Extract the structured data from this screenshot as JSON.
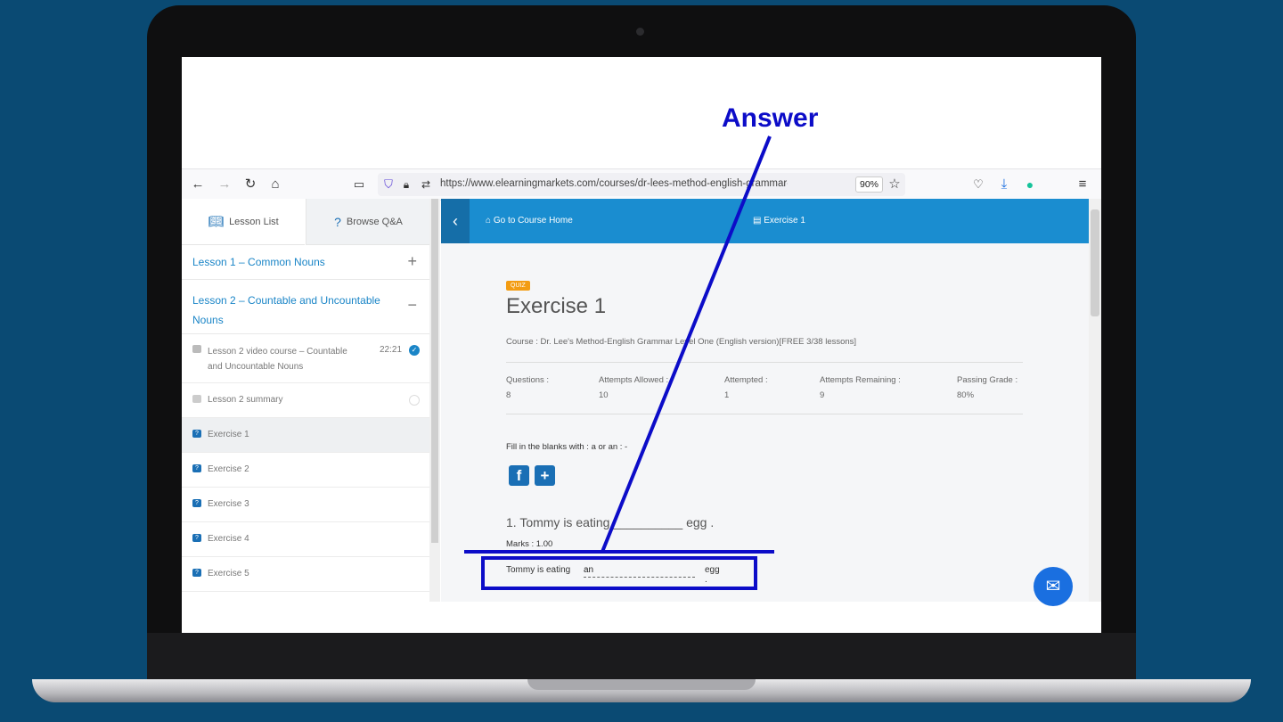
{
  "browser": {
    "url": "https://www.elearningmarkets.com/courses/dr-lees-method-english-grammar-level-one-engl",
    "zoom": "90%"
  },
  "sidebar": {
    "tabs": [
      "Lesson List",
      "Browse Q&A"
    ],
    "lesson1": "Lesson 1 – Common Nouns",
    "lesson2": "Lesson 2 – Countable and Uncountable Nouns",
    "video_line1": "Lesson 2 video course – Countable",
    "video_line2": "and Uncountable Nouns",
    "video_duration": "22:21",
    "summary": "Lesson 2 summary",
    "exercises": [
      "Exercise 1",
      "Exercise 2",
      "Exercise 3",
      "Exercise 4",
      "Exercise 5"
    ]
  },
  "main": {
    "go_home": "Go to Course Home",
    "crumb": "Exercise 1",
    "badge": "QUIZ",
    "title": "Exercise 1",
    "course": "Course : Dr. Lee's Method-English Grammar Level One (English version)[FREE 3/38 lessons]",
    "stats": [
      {
        "label": "Questions :",
        "value": "8"
      },
      {
        "label": "Attempts Allowed :",
        "value": "10"
      },
      {
        "label": "Attempted :",
        "value": "1"
      },
      {
        "label": "Attempts Remaining :",
        "value": "9"
      },
      {
        "label": "Passing Grade :",
        "value": "80%"
      }
    ],
    "instruction": "Fill in the blanks with : a or an : -",
    "question": "1. Tommy is eating __________ egg .",
    "marks": "Marks : 1.00",
    "answer_prefix": "Tommy is eating",
    "answer_value": "an",
    "answer_suffix": "egg ."
  },
  "annotation": {
    "label": "Answer",
    "color": "#0c0cc8"
  }
}
